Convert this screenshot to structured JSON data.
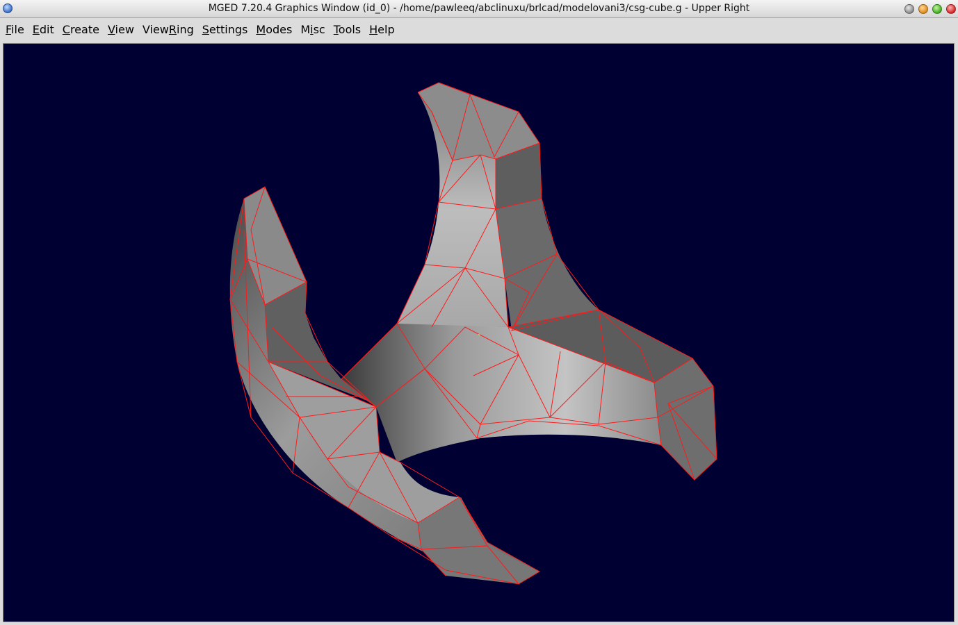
{
  "window": {
    "title": "MGED 7.20.4 Graphics Window (id_0) - /home/pawleeq/abclinuxu/brlcad/modelovani3/csg-cube.g - Upper Right"
  },
  "menu": [
    {
      "label": "File",
      "mnemonic_index": 0
    },
    {
      "label": "Edit",
      "mnemonic_index": 0
    },
    {
      "label": "Create",
      "mnemonic_index": 0
    },
    {
      "label": "View",
      "mnemonic_index": 0
    },
    {
      "label": "ViewRing",
      "mnemonic_index": 4
    },
    {
      "label": "Settings",
      "mnemonic_index": 0
    },
    {
      "label": "Modes",
      "mnemonic_index": 0
    },
    {
      "label": "Misc",
      "mnemonic_index": 1
    },
    {
      "label": "Tools",
      "mnemonic_index": 0
    },
    {
      "label": "Help",
      "mnemonic_index": 0
    }
  ],
  "colors": {
    "viewport_background": "#000032",
    "wireframe": "#ff1a1a",
    "shaded_light": "#b4b4b4",
    "shaded_dark": "#5a5a5a"
  },
  "icons": [
    "window-menu-icon",
    "shade-icon",
    "minimize-icon",
    "maximize-icon",
    "close-icon"
  ]
}
